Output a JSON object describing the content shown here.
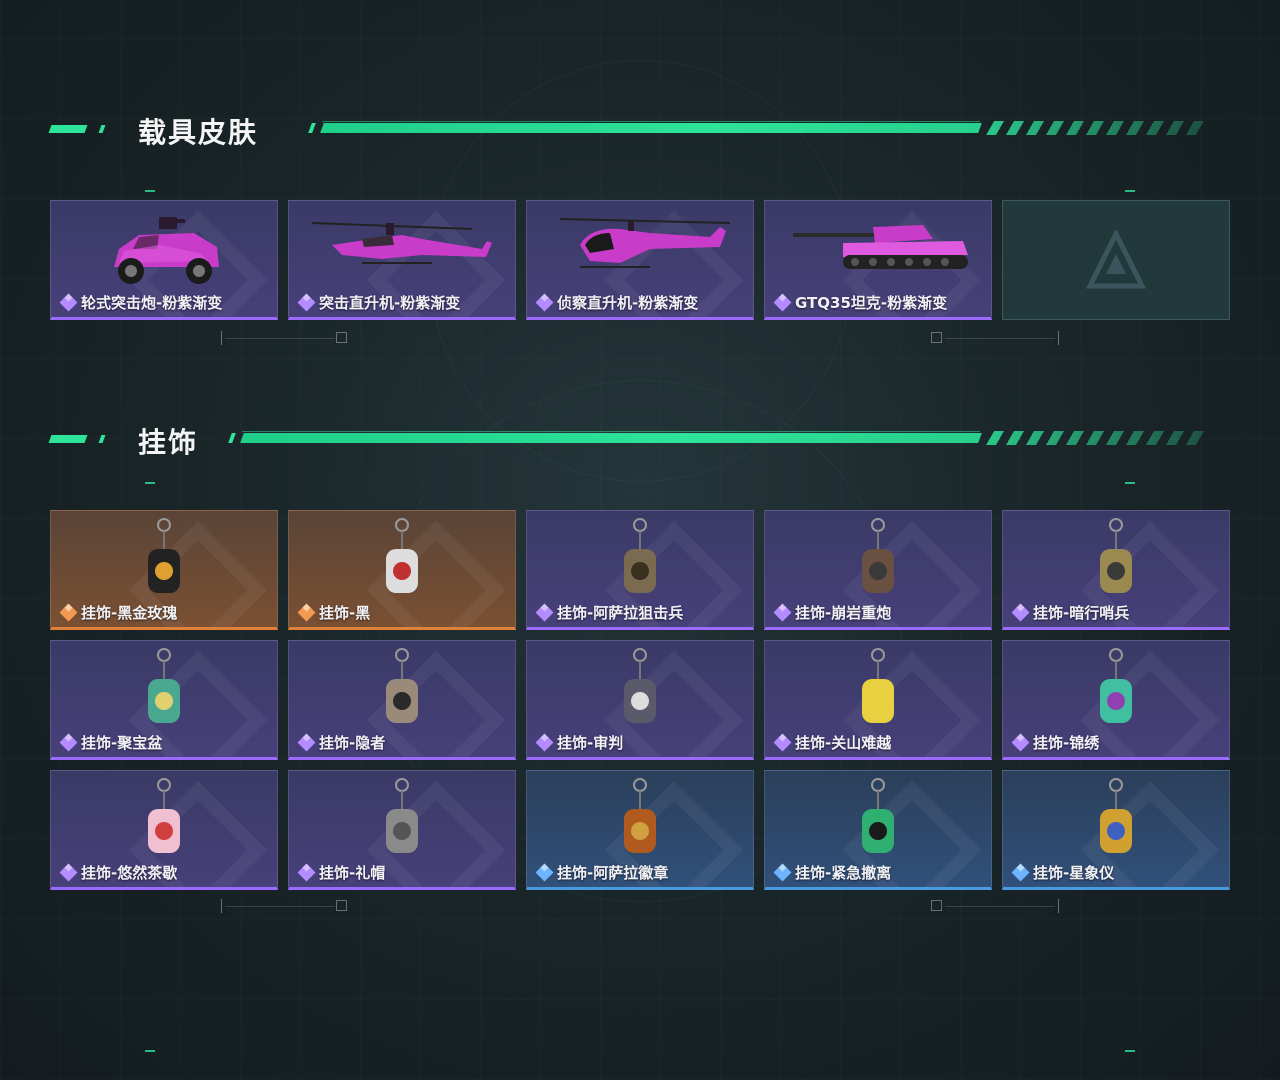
{
  "sections": [
    {
      "title": "载具皮肤",
      "items": [
        {
          "label": "轮式突击炮-粉紫渐变",
          "rarity": "purple",
          "icon": "armored-vehicle-icon"
        },
        {
          "label": "突击直升机-粉紫渐变",
          "rarity": "purple",
          "icon": "attack-helicopter-icon"
        },
        {
          "label": "侦察直升机-粉紫渐变",
          "rarity": "purple",
          "icon": "scout-helicopter-icon"
        },
        {
          "label": "GTQ35坦克-粉紫渐变",
          "rarity": "purple",
          "icon": "tank-icon"
        },
        {
          "label": "",
          "rarity": "empty",
          "icon": "game-logo-icon"
        }
      ]
    },
    {
      "title": "挂饰",
      "items": [
        {
          "label": "挂饰-黑金玫瑰",
          "rarity": "orange",
          "icon": "pendant-icon"
        },
        {
          "label": "挂饰-黑",
          "rarity": "orange",
          "icon": "pendant-icon"
        },
        {
          "label": "挂饰-阿萨拉狙击兵",
          "rarity": "purple",
          "icon": "pendant-icon"
        },
        {
          "label": "挂饰-崩岩重炮",
          "rarity": "purple",
          "icon": "pendant-icon"
        },
        {
          "label": "挂饰-暗行哨兵",
          "rarity": "purple",
          "icon": "pendant-icon"
        },
        {
          "label": "挂饰-聚宝盆",
          "rarity": "purple",
          "icon": "pendant-icon"
        },
        {
          "label": "挂饰-隐者",
          "rarity": "purple",
          "icon": "pendant-icon"
        },
        {
          "label": "挂饰-审判",
          "rarity": "purple",
          "icon": "pendant-icon"
        },
        {
          "label": "挂饰-关山难越",
          "rarity": "purple",
          "icon": "pendant-icon"
        },
        {
          "label": "挂饰-锦绣",
          "rarity": "purple",
          "icon": "pendant-icon"
        },
        {
          "label": "挂饰-悠然茶歇",
          "rarity": "purple",
          "icon": "pendant-icon"
        },
        {
          "label": "挂饰-礼帽",
          "rarity": "purple",
          "icon": "pendant-icon"
        },
        {
          "label": "挂饰-阿萨拉徽章",
          "rarity": "blue",
          "icon": "pendant-icon"
        },
        {
          "label": "挂饰-紧急撤离",
          "rarity": "blue",
          "icon": "pendant-icon"
        },
        {
          "label": "挂饰-星象仪",
          "rarity": "blue",
          "icon": "pendant-icon"
        }
      ]
    }
  ],
  "colors": {
    "accent": "#2ee39a",
    "purple": "#9b6bff",
    "orange": "#e0803a",
    "blue": "#4a9ae0"
  }
}
